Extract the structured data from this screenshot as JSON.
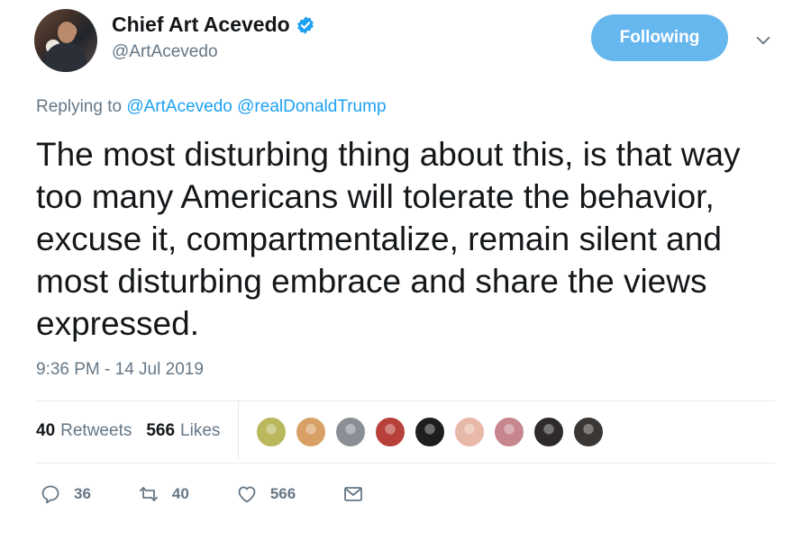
{
  "author": {
    "display_name": "Chief Art Acevedo",
    "handle": "@ArtAcevedo",
    "verified": true
  },
  "follow_button": {
    "label": "Following"
  },
  "reply_context": {
    "prefix": "Replying to",
    "mentions": [
      "@ArtAcevedo",
      "@realDonaldTrump"
    ]
  },
  "tweet": {
    "text": "The most disturbing thing about this, is that way too many Americans will tolerate the behavior, excuse it, compartmentalize, remain silent and most disturbing embrace and share the views expressed.",
    "timestamp": "9:36 PM - 14 Jul 2019"
  },
  "stats": {
    "retweets_count": "40",
    "retweets_label": "Retweets",
    "likes_count": "566",
    "likes_label": "Likes"
  },
  "likers": [
    {
      "icon": "liker-avatar-1",
      "color": "#b9b85c"
    },
    {
      "icon": "liker-avatar-2",
      "color": "#d9a066"
    },
    {
      "icon": "liker-avatar-3",
      "color": "#8a8f96"
    },
    {
      "icon": "liker-avatar-4",
      "color": "#b8403a"
    },
    {
      "icon": "liker-avatar-5",
      "color": "#1e1e1e"
    },
    {
      "icon": "liker-avatar-6",
      "color": "#e8b8a8"
    },
    {
      "icon": "liker-avatar-7",
      "color": "#c7868e"
    },
    {
      "icon": "liker-avatar-8",
      "color": "#2e2a2a"
    },
    {
      "icon": "liker-avatar-9",
      "color": "#3a3633"
    }
  ],
  "actions": {
    "reply_count": "36",
    "retweet_count": "40",
    "like_count": "566"
  },
  "colors": {
    "accent": "#1da1f2",
    "follow_button_bg": "#67b7ef",
    "muted_text": "#657786",
    "primary_text": "#14171a"
  }
}
